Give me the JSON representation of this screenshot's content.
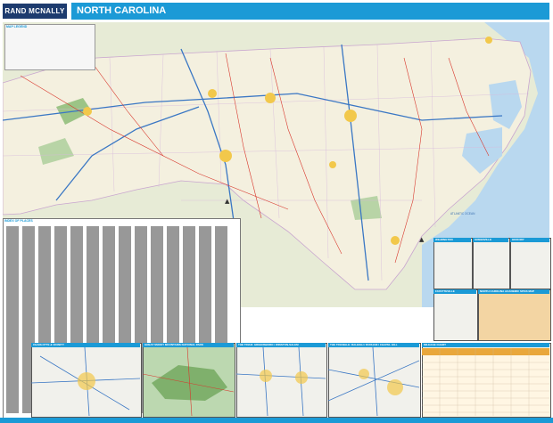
{
  "header": {
    "brand": "RAND MCNALLY",
    "title": "NORTH CAROLINA"
  },
  "legend": {
    "title": "MAP LEGEND"
  },
  "map": {
    "ocean_label": "ATLANTIC OCEAN",
    "compass_symbol": "compass-icon",
    "colors": {
      "land": "#f4f0df",
      "neighbor_land": "#e7ebd6",
      "water": "#b9d8ef",
      "interstate": "#3a77c4",
      "highway": "#d8392e",
      "county_line": "#c9a6cf",
      "forest": "#9cc486",
      "urban": "#f2c84b"
    }
  },
  "index": {
    "title": "INDEX OF PLACES"
  },
  "insets": [
    {
      "label": "WILMINGTON"
    },
    {
      "label": "GREENVILLE"
    },
    {
      "label": "HICKORY"
    },
    {
      "label": "FAYETTEVILLE"
    },
    {
      "label": "NORTH CAROLINA ACADEMIC SITES MAP"
    },
    {
      "label": "CHARLOTTE & VICINITY"
    },
    {
      "label": "GREAT SMOKY MOUNTAINS NATIONAL PARK"
    },
    {
      "label": "THE TRIAD: GREENSBORO / WINSTON-SALEM"
    },
    {
      "label": "THE TRIANGLE: RALEIGH / DURHAM / CHAPEL HILL"
    },
    {
      "label": "MILEAGE CHART"
    }
  ],
  "mileage": {
    "header_color": "#e9a73b"
  }
}
